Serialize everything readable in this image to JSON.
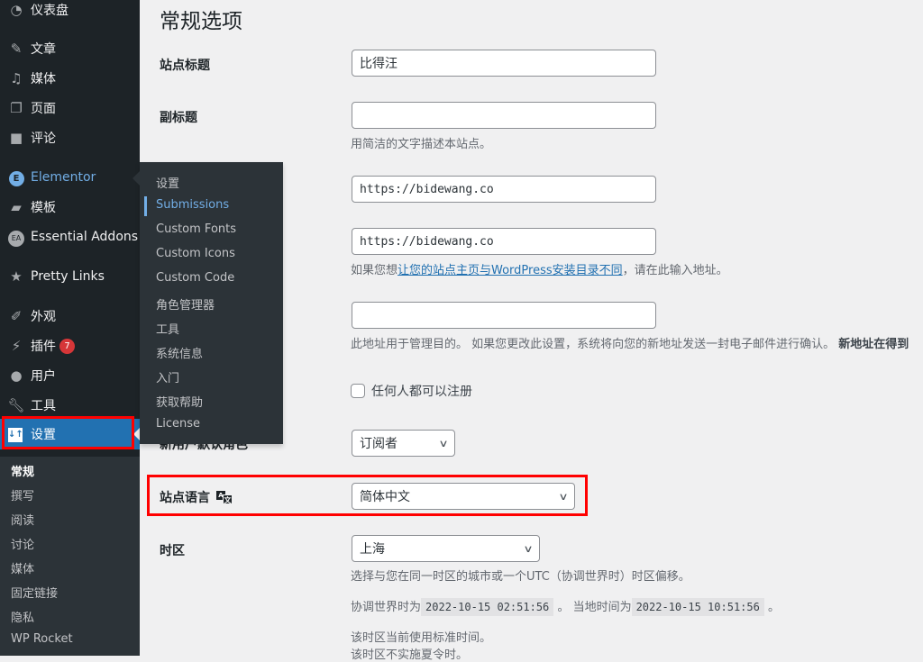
{
  "sidebar": {
    "items": [
      {
        "label": "仪表盘",
        "icon": "dashboard-icon"
      },
      {
        "label": "文章",
        "icon": "pin-icon"
      },
      {
        "label": "媒体",
        "icon": "media-icon"
      },
      {
        "label": "页面",
        "icon": "page-icon"
      },
      {
        "label": "评论",
        "icon": "comment-icon"
      },
      {
        "label": "Elementor",
        "icon": "elementor-icon"
      },
      {
        "label": "模板",
        "icon": "folder-icon"
      },
      {
        "label": "Essential Addons",
        "icon": "ea-icon"
      },
      {
        "label": "Pretty Links",
        "icon": "star-icon"
      },
      {
        "label": "外观",
        "icon": "brush-icon"
      },
      {
        "label": "插件",
        "icon": "plugin-icon",
        "badge": "7"
      },
      {
        "label": "用户",
        "icon": "user-icon"
      },
      {
        "label": "工具",
        "icon": "wrench-icon"
      },
      {
        "label": "设置",
        "icon": "settings-icon"
      }
    ],
    "submenu": [
      "常规",
      "撰写",
      "阅读",
      "讨论",
      "媒体",
      "固定链接",
      "隐私",
      "WP Rocket"
    ]
  },
  "flyout": [
    "设置",
    "Submissions",
    "Custom Fonts",
    "Custom Icons",
    "Custom Code",
    "角色管理器",
    "工具",
    "系统信息",
    "入门",
    "获取帮助",
    "License"
  ],
  "page": {
    "title": "常规选项",
    "site_title_label": "站点标题",
    "site_title": "比得汪",
    "tagline_label": "副标题",
    "tagline": "",
    "tagline_desc": "用简洁的文字描述本站点。",
    "wp_url": "https://bidewang.co",
    "site_url": "https://bidewang.co",
    "site_url_desc_pre": "如果您想",
    "site_url_desc_link": "让您的站点主页与WordPress安装目录不同",
    "site_url_desc_post": "，请在此输入地址。",
    "email": "",
    "email_desc": "此地址用于管理目的。 如果您更改此设置，系统将向您的新地址发送一封电子邮件进行确认。 ",
    "email_desc_bold": "新地址在得到",
    "membership": "任何人都可以注册",
    "membership_checked": false,
    "role_label": "新用户默认角色",
    "role": "订阅者",
    "language_label": "站点语言",
    "language": "简体中文",
    "timezone_label": "时区",
    "timezone": "上海",
    "tz_desc": "选择与您在同一时区的城市或一个UTC（协调世界时）时区偏移。",
    "utc_pre": "协调世界时为",
    "utc_time": "2022-10-15 02:51:56",
    "local_pre": "。 当地时间为",
    "local_time": "2022-10-15 10:51:56",
    "local_post": "。",
    "std_time": "该时区当前使用标准时间。",
    "no_dst": "该时区不实施夏令时。"
  },
  "colors": {
    "sidebar": "#1d2327",
    "accent": "#2271b1",
    "highlight": "#ff0000"
  }
}
